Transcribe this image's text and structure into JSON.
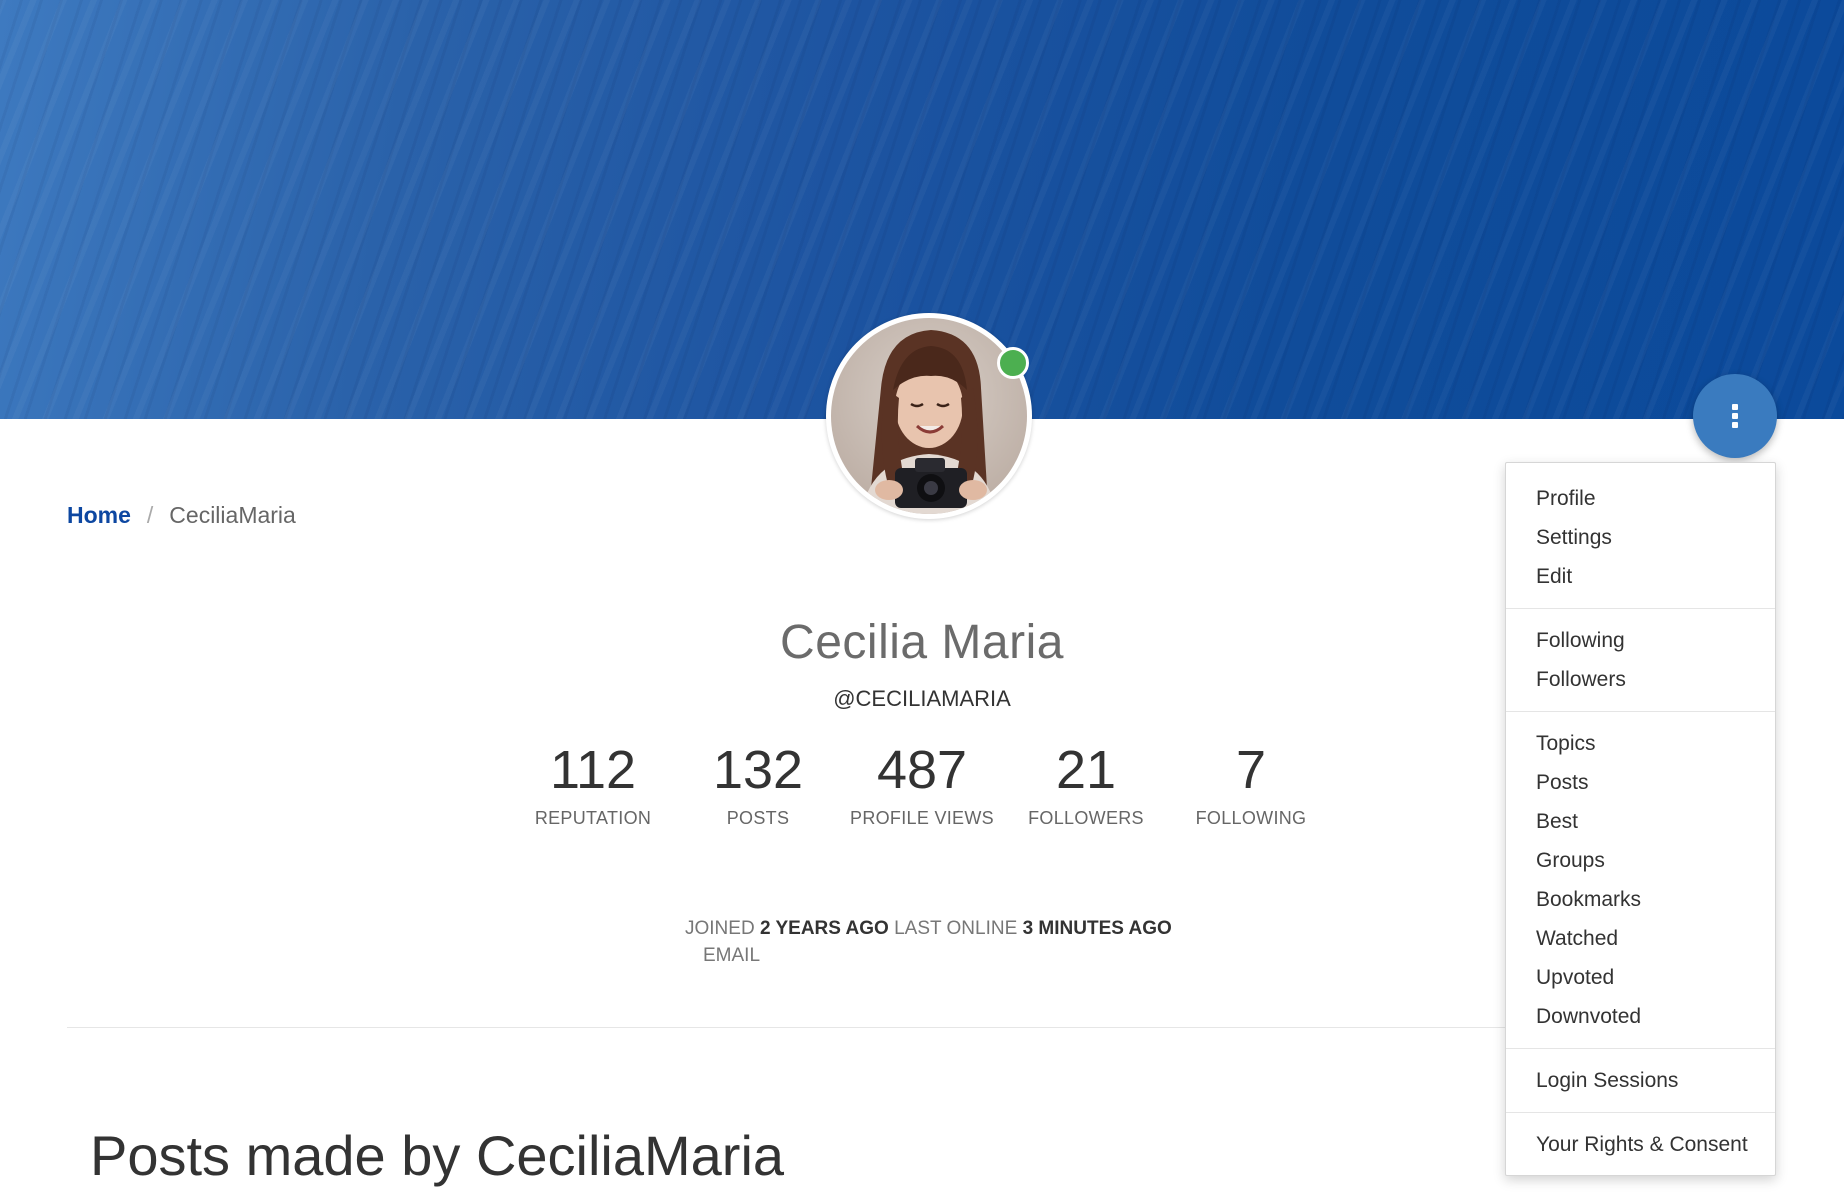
{
  "breadcrumb": {
    "home": "Home",
    "separator": "/",
    "current": "CeciliaMaria"
  },
  "profile": {
    "full_name": "Cecilia Maria",
    "username": "@CECILIAMARIA",
    "online": true,
    "status_color": "#4caf50"
  },
  "stats": [
    {
      "value": "112",
      "label": "REPUTATION"
    },
    {
      "value": "132",
      "label": "POSTS"
    },
    {
      "value": "487",
      "label": "PROFILE VIEWS"
    },
    {
      "value": "21",
      "label": "FOLLOWERS"
    },
    {
      "value": "7",
      "label": "FOLLOWING"
    }
  ],
  "meta": {
    "joined_label": "JOINED",
    "joined_value": "2 YEARS AGO",
    "last_online_label": "LAST ONLINE",
    "last_online_value": "3 MINUTES AGO",
    "email_label": "EMAIL"
  },
  "posts_title": "Posts made by CeciliaMaria",
  "menu": {
    "groups": [
      [
        "Profile",
        "Settings",
        "Edit"
      ],
      [
        "Following",
        "Followers"
      ],
      [
        "Topics",
        "Posts",
        "Best",
        "Groups",
        "Bookmarks",
        "Watched",
        "Upvoted",
        "Downvoted"
      ],
      [
        "Login Sessions"
      ],
      [
        "Your Rights & Consent"
      ]
    ]
  },
  "colors": {
    "cover": "#1d54a1",
    "accent": "#0d47a1",
    "fab": "#3a7bbf"
  },
  "icons": {
    "menu_button": "vertical-ellipsis-icon"
  }
}
